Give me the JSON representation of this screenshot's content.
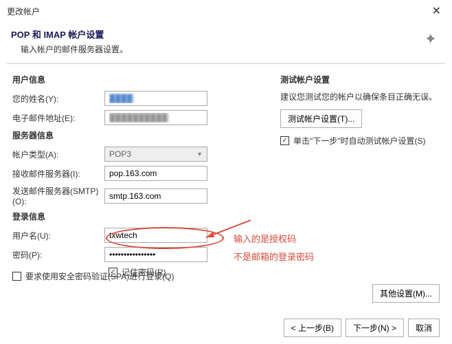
{
  "titlebar": {
    "title": "更改帐户"
  },
  "header": {
    "title": "POP 和 IMAP 帐户设置",
    "subtitle": "输入帐户的邮件服务器设置。"
  },
  "sections": {
    "user_info": "用户信息",
    "server_info": "服务器信息",
    "login_info": "登录信息"
  },
  "labels": {
    "name": "您的姓名(Y):",
    "email": "电子邮件地址(E):",
    "account_type": "帐户类型(A):",
    "incoming": "接收邮件服务器(I):",
    "outgoing": "发送邮件服务器(SMTP)(O):",
    "username": "用户名(U):",
    "password": "密码(P):",
    "remember": "记住密码(R)",
    "spa": "要求使用安全密码验证(SPA)进行登录(Q)"
  },
  "values": {
    "name": "████",
    "email": "██████████",
    "account_type": "POP3",
    "incoming": "pop.163.com",
    "outgoing": "smtp.163.com",
    "username": "txwtech",
    "password": "****************"
  },
  "right": {
    "test_title": "测试帐户设置",
    "test_note": "建议您测试您的帐户以确保条目正确无误。",
    "test_btn": "测试帐户设置(T)...",
    "auto_test": "单击\"下一步\"时自动测试帐户设置(S)",
    "other_btn": "其他设置(M)..."
  },
  "annotations": {
    "line1": "输入的是授权码",
    "line2": "不是邮箱的登录密码"
  },
  "footer": {
    "back": "< 上一步(B)",
    "next": "下一步(N) >",
    "cancel": "取消"
  }
}
